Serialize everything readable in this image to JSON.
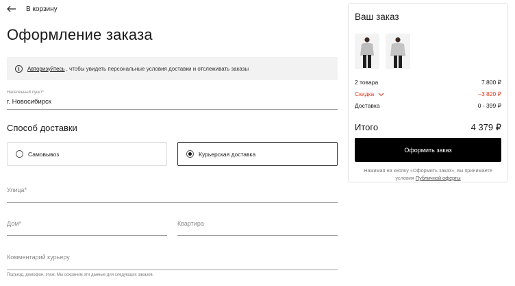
{
  "header": {
    "back_label": "В корзину"
  },
  "page_title": "Оформление заказа",
  "auth_banner": {
    "link": "Авторизуйтесь",
    "text": ", чтобы увидеть персональные условия доставки и отслеживать заказы"
  },
  "city": {
    "label": "Населенный пункт*",
    "value": "г. Новосибирск"
  },
  "delivery": {
    "title": "Способ доставки",
    "options": [
      {
        "label": "Самовывоз",
        "selected": false
      },
      {
        "label": "Курьерская доставка",
        "selected": true
      }
    ]
  },
  "form": {
    "street": "Улица*",
    "house": "Дом*",
    "apartment": "Квартира",
    "comment": "Комментарий курьеру",
    "hint": "Подъезд, домофон, этаж. Мы сохраним эти данные для следующих заказов."
  },
  "summary": {
    "title": "Ваш заказ",
    "items_label": "2 товара",
    "items_value": "7 800 ₽",
    "discount_label": "Скидка",
    "discount_value": "–3 820 ₽",
    "delivery_label": "Доставка",
    "delivery_value": "0 - 399 ₽",
    "total_label": "Итого",
    "total_value": "4 379 ₽",
    "checkout_button": "Оформить заказ",
    "terms_text": "Нажимая на кнопку «Оформить заказ», вы принимаете условия",
    "terms_link": "Публичной оферты"
  },
  "colors": {
    "accent": "#000000",
    "discount": "#e4381e",
    "banner_bg": "#f2f2f2"
  },
  "icons": [
    "arrow-left-icon",
    "info-icon",
    "chevron-down-icon"
  ]
}
